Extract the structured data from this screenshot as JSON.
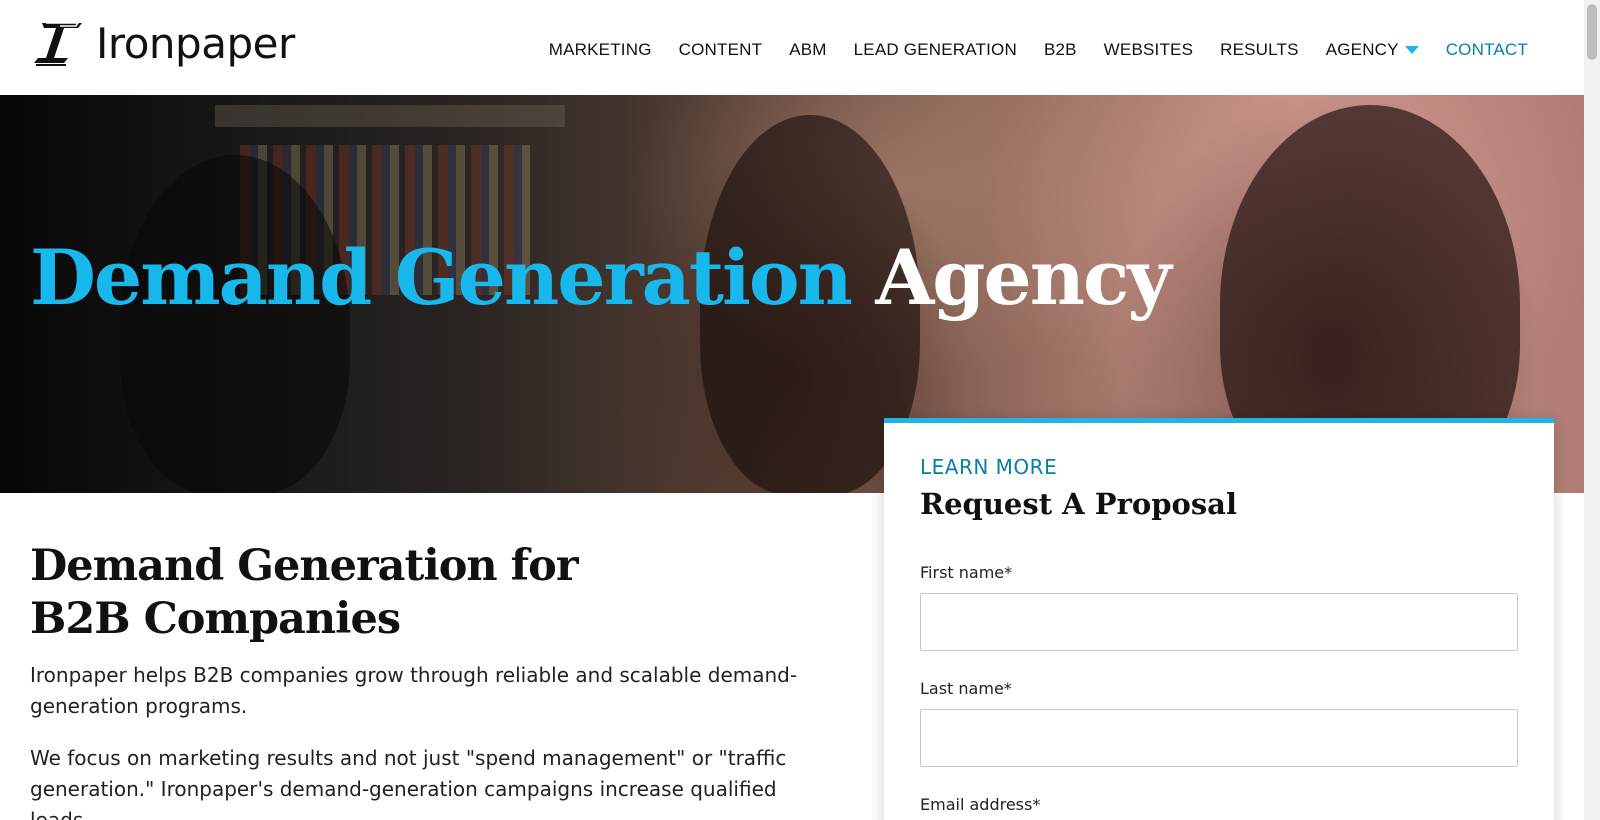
{
  "header": {
    "logo_text": "Ironpaper",
    "nav": {
      "marketing": "MARKETING",
      "content": "CONTENT",
      "abm": "ABM",
      "lead_generation": "LEAD GENERATION",
      "b2b": "B2B",
      "websites": "WEBSITES",
      "results": "RESULTS",
      "agency": "AGENCY",
      "contact": "CONTACT"
    }
  },
  "hero": {
    "title_highlight": "Demand Generation",
    "title_rest": "Agency"
  },
  "main": {
    "heading": "Demand Generation for B2B Companies",
    "paragraph_1": "Ironpaper helps B2B companies grow through reliable and scalable demand-generation programs.",
    "paragraph_2": "We focus on marketing results and not just \"spend management\" or \"traffic generation.\" Ironpaper's demand-generation campaigns increase qualified leads,"
  },
  "form": {
    "eyebrow": "LEARN MORE",
    "title": "Request A Proposal",
    "first_name_label": "First name*",
    "first_name_value": "",
    "last_name_label": "Last name*",
    "last_name_value": "",
    "email_label": "Email address*"
  },
  "colors": {
    "accent_blue": "#18b8ec",
    "link_blue": "#0b7ea8"
  },
  "icons": {
    "logo": "ironpaper-logo-icon",
    "agency_dropdown": "caret-down-icon"
  }
}
